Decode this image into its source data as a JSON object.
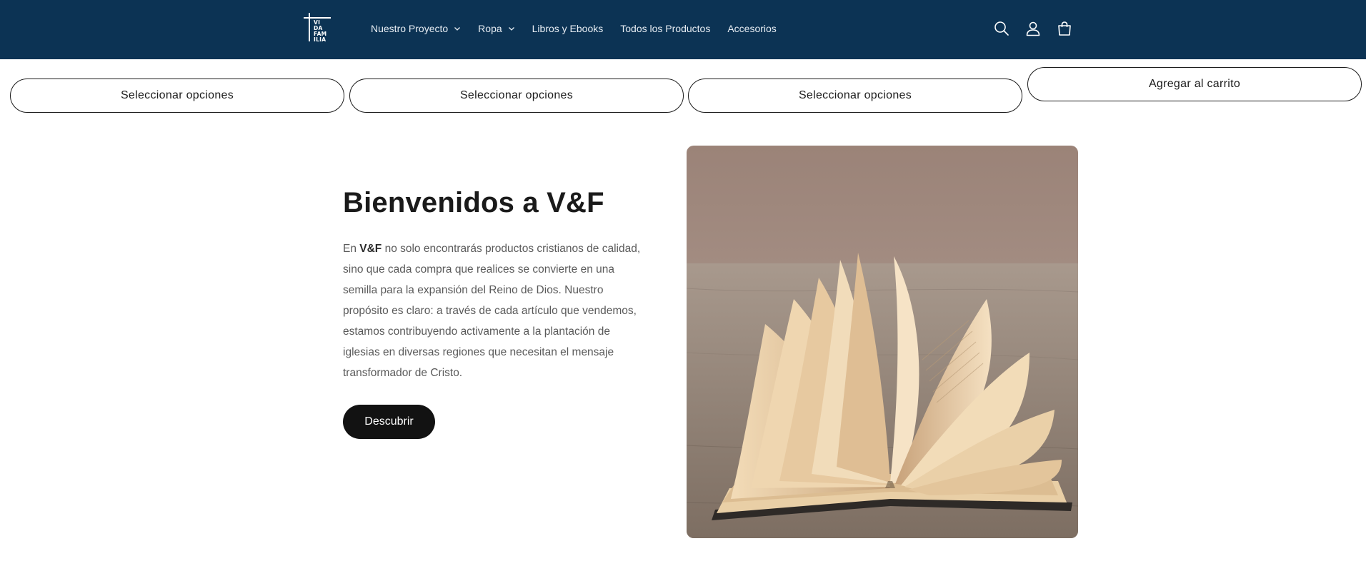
{
  "header": {
    "logo": {
      "text": "VI\nDA\nFAM\nILIA",
      "icon": "cross-logo-icon"
    },
    "nav": [
      {
        "label": "Nuestro Proyecto",
        "has_dropdown": true
      },
      {
        "label": "Ropa",
        "has_dropdown": true
      },
      {
        "label": "Libros y Ebooks",
        "has_dropdown": false
      },
      {
        "label": "Todos los Productos",
        "has_dropdown": false
      },
      {
        "label": "Accesorios",
        "has_dropdown": false
      }
    ],
    "icons": [
      "search-icon",
      "account-icon",
      "cart-icon"
    ],
    "colors": {
      "background": "#0c3354",
      "text": "#e7edf3"
    }
  },
  "product_buttons": [
    {
      "label": "Seleccionar opciones"
    },
    {
      "label": "Seleccionar opciones"
    },
    {
      "label": "Seleccionar opciones"
    },
    {
      "label": "Agregar al carrito"
    }
  ],
  "hero": {
    "title": "Bienvenidos a V&F",
    "body_prefix": "En ",
    "body_bold": "V&F",
    "body_rest": " no solo encontrarás productos cristianos de calidad, sino que cada compra que realices se convierte en una semilla para la expansión del Reino de Dios. Nuestro propósito es claro: a través de cada artículo que vendemos, estamos contribuyendo activamente a la plantación de iglesias en diversas regiones que necesitan el mensaje transformador de Cristo.",
    "button_label": "Descubrir",
    "image": "open-book-image"
  }
}
